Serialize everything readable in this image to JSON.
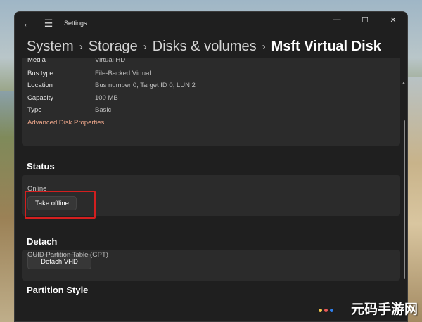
{
  "window": {
    "app_title": "Settings",
    "controls": {
      "minimize": "—",
      "maximize": "☐",
      "close": "✕"
    }
  },
  "breadcrumb": {
    "items": [
      "System",
      "Storage",
      "Disks & volumes"
    ],
    "current": "Msft Virtual Disk",
    "separator": "›"
  },
  "properties": {
    "rows": [
      {
        "label": "Media",
        "value": "Virtual HD"
      },
      {
        "label": "Bus type",
        "value": "File-Backed Virtual"
      },
      {
        "label": "Location",
        "value": "Bus number 0, Target ID 0, LUN 2"
      },
      {
        "label": "Capacity",
        "value": "100 MB"
      },
      {
        "label": "Type",
        "value": "Basic"
      }
    ],
    "advanced_link": "Advanced Disk Properties"
  },
  "status": {
    "title": "Status",
    "state": "Online",
    "button": "Take offline"
  },
  "detach": {
    "title": "Detach",
    "button": "Detach VHD"
  },
  "partition_style": {
    "title": "Partition Style",
    "value": "GUID Partition Table (GPT)"
  },
  "icons": {
    "back": "←",
    "menu": "☰",
    "scroll_up": "▲"
  },
  "watermark": "元码手游网",
  "colors": {
    "accent_link": "#f0a88c",
    "highlight": "#d31f1f",
    "window_bg": "#1f1f1f",
    "panel_bg": "#2b2b2b"
  }
}
